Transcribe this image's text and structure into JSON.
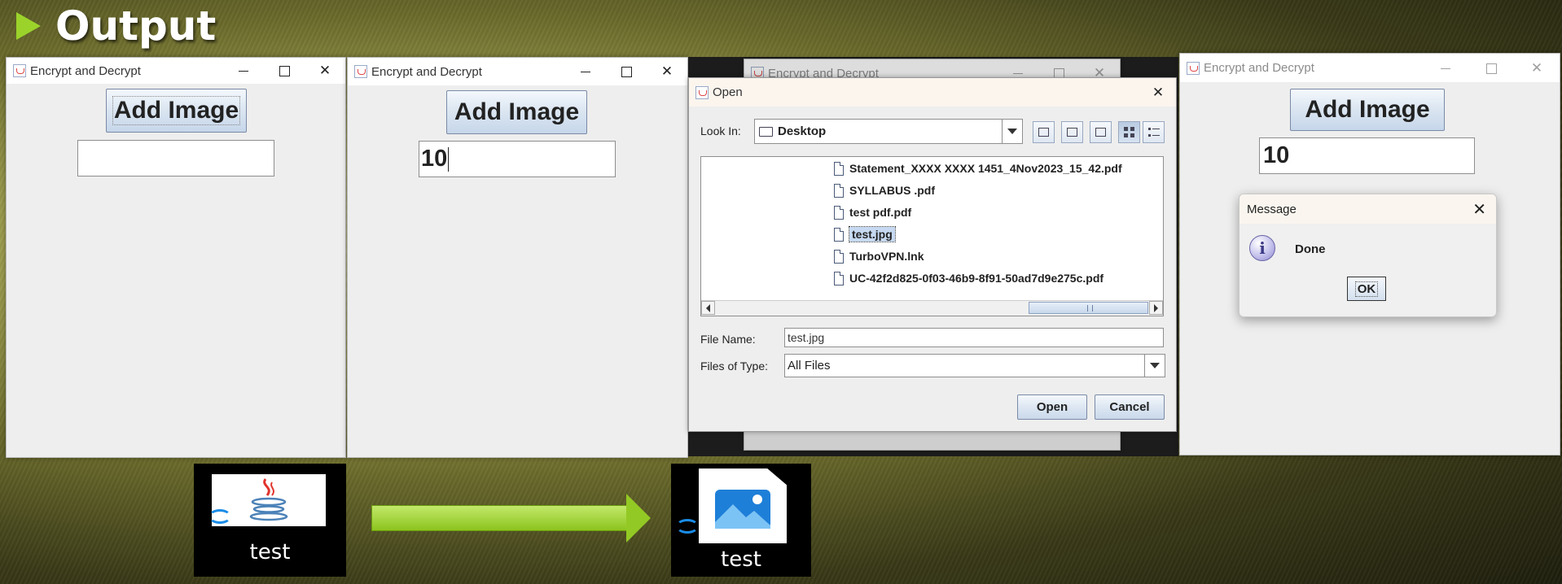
{
  "slide": {
    "title": "Output"
  },
  "app_window_title": "Encrypt and Decrypt",
  "window_controls": {
    "minimize": "–",
    "close": "✕"
  },
  "panel1": {
    "add_button": "Add Image",
    "field_value": ""
  },
  "panel2": {
    "add_button": "Add Image",
    "field_value": "10"
  },
  "panel4": {
    "add_button": "Add Image",
    "field_value": "10"
  },
  "open_dialog": {
    "title": "Open",
    "look_in_label": "Look In:",
    "look_in_value": "Desktop",
    "files": [
      {
        "name": "Statement_XXXX XXXX 1451_4Nov2023_15_42.pdf",
        "selected": false
      },
      {
        "name": "SYLLABUS .pdf",
        "selected": false
      },
      {
        "name": "test pdf.pdf",
        "selected": false
      },
      {
        "name": "test.jpg",
        "selected": true
      },
      {
        "name": "TurboVPN.lnk",
        "selected": false
      },
      {
        "name": "UC-42f2d825-0f03-46b9-8f91-50ad7d9e275c.pdf",
        "selected": false
      }
    ],
    "file_name_label": "File Name:",
    "file_name_value": "test.jpg",
    "file_type_label": "Files of Type:",
    "file_type_value": "All Files",
    "open_button": "Open",
    "cancel_button": "Cancel"
  },
  "message_dialog": {
    "title": "Message",
    "text": "Done",
    "ok_button": "OK",
    "close": "✕",
    "icon": "information-icon"
  },
  "icons": {
    "before_label": "test",
    "after_label": "test",
    "before_icon": "java-file-icon",
    "after_icon": "image-file-icon"
  },
  "colors": {
    "accent_green": "#9bd32b",
    "button_blue": "#c6d6ea",
    "selection": "#c6d9f1"
  }
}
